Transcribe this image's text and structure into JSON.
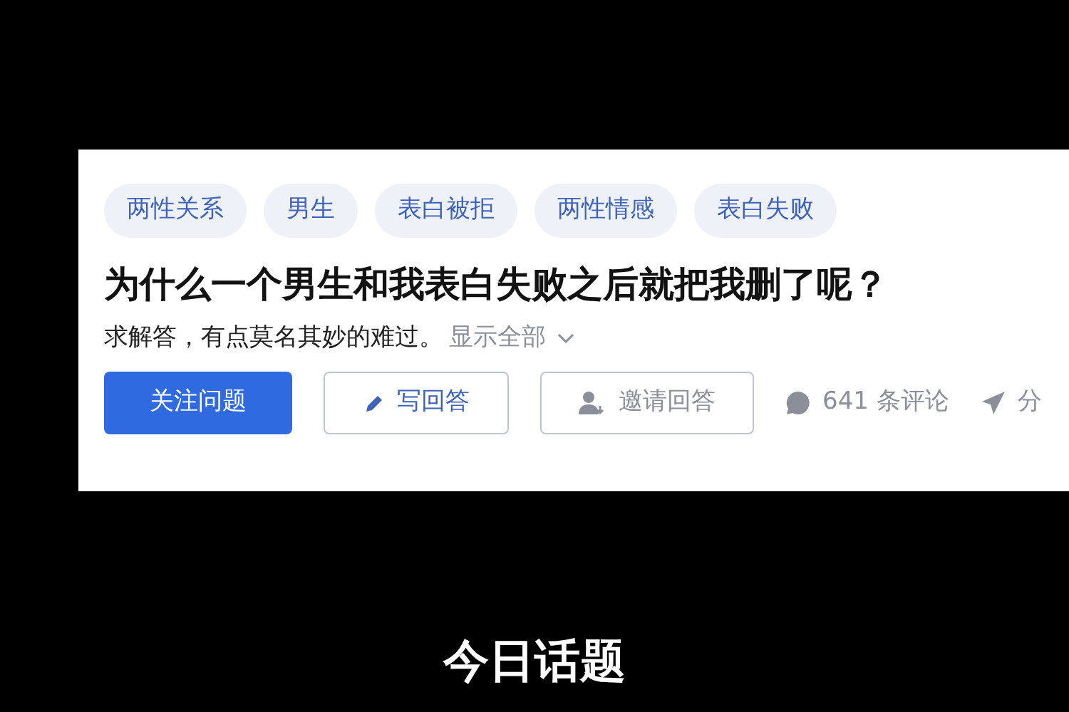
{
  "question": {
    "tags": [
      "两性关系",
      "男生",
      "表白被拒",
      "两性情感",
      "表白失败"
    ],
    "title": "为什么一个男生和我表白失败之后就把我删了呢？",
    "description": "求解答，有点莫名其妙的难过。",
    "show_all": "显示全部",
    "buttons": [
      {
        "kind": "primary",
        "label": "关注问题"
      },
      {
        "kind": "write",
        "label": "写回答"
      },
      {
        "kind": "invite",
        "label": "邀请回答"
      }
    ],
    "comments": "641 条评论",
    "share": "分"
  },
  "caption": "今日话题"
}
